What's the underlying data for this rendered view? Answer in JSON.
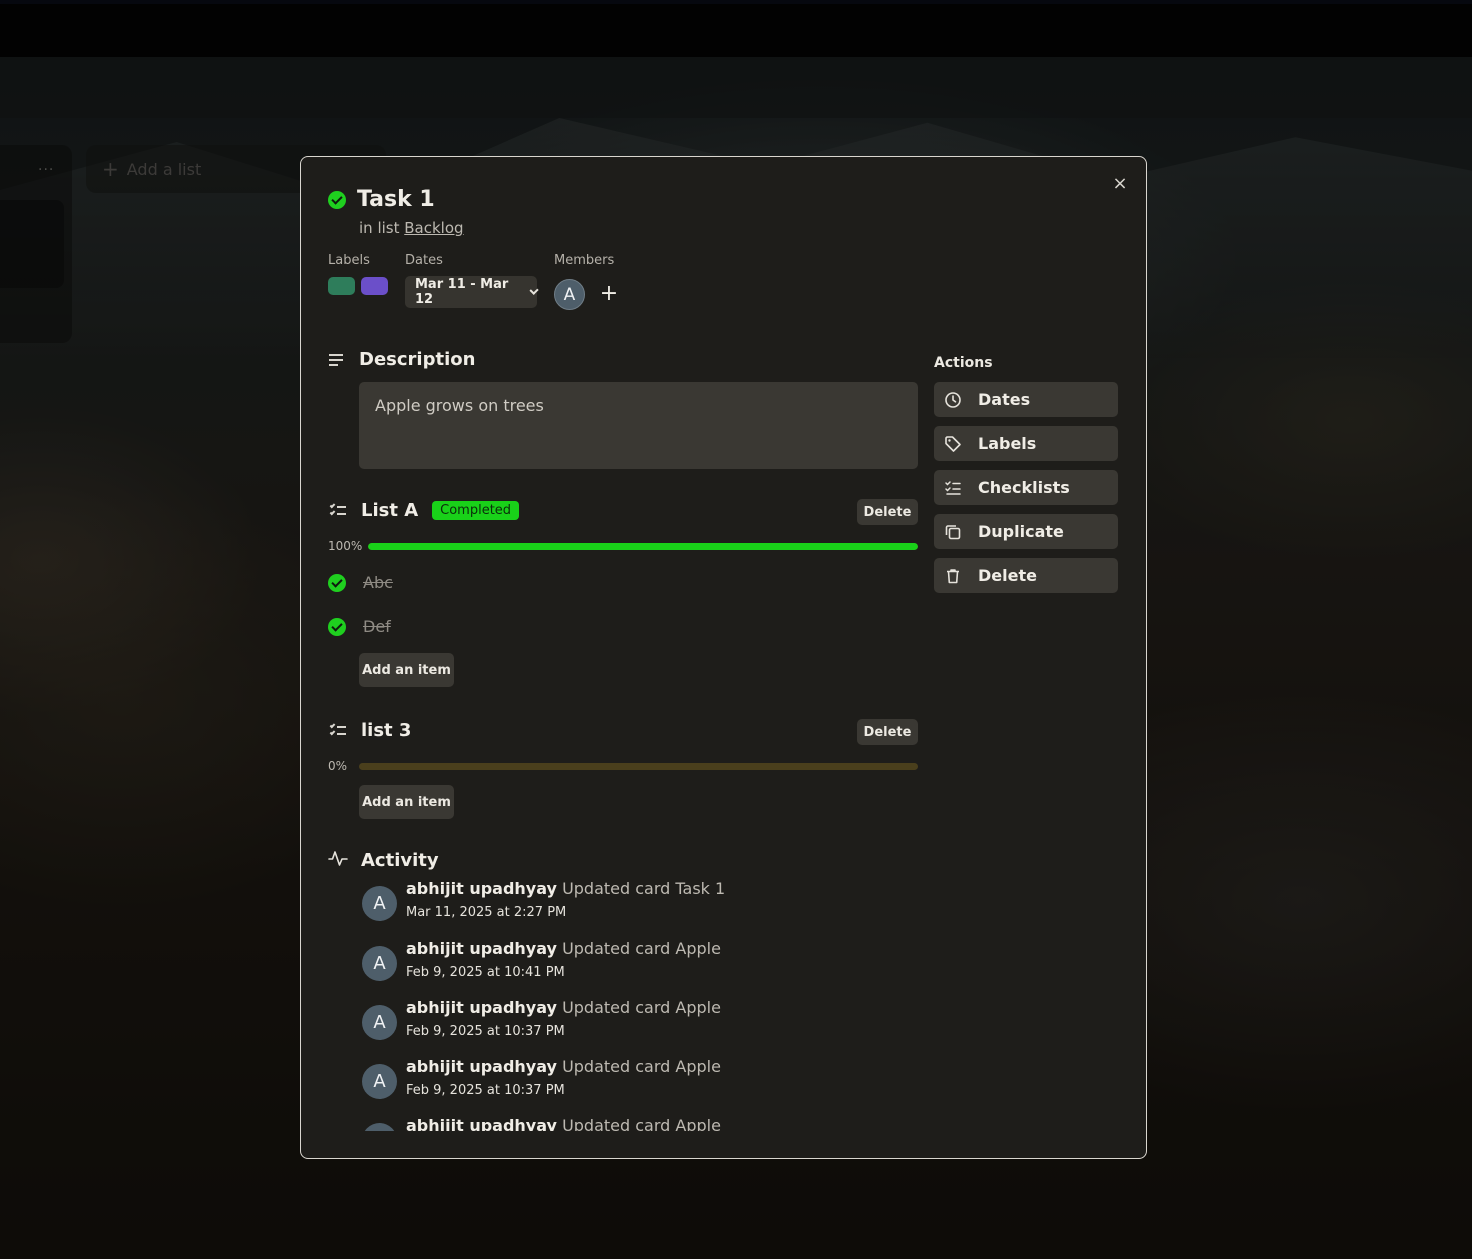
{
  "background": {
    "add_list_label": "Add a list",
    "list_menu_label": "..."
  },
  "card": {
    "title": "Task 1",
    "list_prefix": "in list",
    "list_name": "Backlog",
    "close_label": "×",
    "labels_heading": "Labels",
    "labels": [
      {
        "color": "#2e7d5b"
      },
      {
        "color": "#6b4fc9"
      }
    ],
    "dates_heading": "Dates",
    "dates_value": "Mar 11 - Mar 12",
    "members_heading": "Members",
    "member_initial": "A",
    "add_member_label": "+"
  },
  "description": {
    "heading": "Description",
    "text": "Apple grows on trees"
  },
  "checklists": [
    {
      "title": "List A",
      "badge": "Completed",
      "delete_label": "Delete",
      "progress_label": "100%",
      "progress": 1.0,
      "items": [
        {
          "text": "Abc",
          "done": true
        },
        {
          "text": "Def",
          "done": true
        }
      ],
      "add_item_label": "Add an item"
    },
    {
      "title": "list 3",
      "badge": "",
      "delete_label": "Delete",
      "progress_label": "0%",
      "progress": 0.0,
      "items": [],
      "add_item_label": "Add an item"
    }
  ],
  "actions": {
    "heading": "Actions",
    "items": [
      {
        "label": "Dates",
        "icon": "clock-icon"
      },
      {
        "label": "Labels",
        "icon": "tag-icon"
      },
      {
        "label": "Checklists",
        "icon": "checklist-icon"
      },
      {
        "label": "Duplicate",
        "icon": "copy-icon"
      },
      {
        "label": "Delete",
        "icon": "trash-icon"
      }
    ]
  },
  "activity": {
    "heading": "Activity",
    "entries": [
      {
        "initial": "A",
        "user": "abhijit upadhyay",
        "action": "Updated card Task 1",
        "time": "Mar 11, 2025 at 2:27 PM"
      },
      {
        "initial": "A",
        "user": "abhijit upadhyay",
        "action": "Updated card Apple",
        "time": "Feb 9, 2025 at 10:41 PM"
      },
      {
        "initial": "A",
        "user": "abhijit upadhyay",
        "action": "Updated card Apple",
        "time": "Feb 9, 2025 at 10:37 PM"
      },
      {
        "initial": "A",
        "user": "abhijit upadhyay",
        "action": "Updated card Apple",
        "time": "Feb 9, 2025 at 10:37 PM"
      },
      {
        "initial": "A",
        "user": "abhijit upadhyay",
        "action": "Updated card Apple",
        "time": ""
      }
    ]
  },
  "colors": {
    "accent_green": "#19d119",
    "progress_empty": "#4a3f1c",
    "modal_bg": "#1e1d1a"
  }
}
